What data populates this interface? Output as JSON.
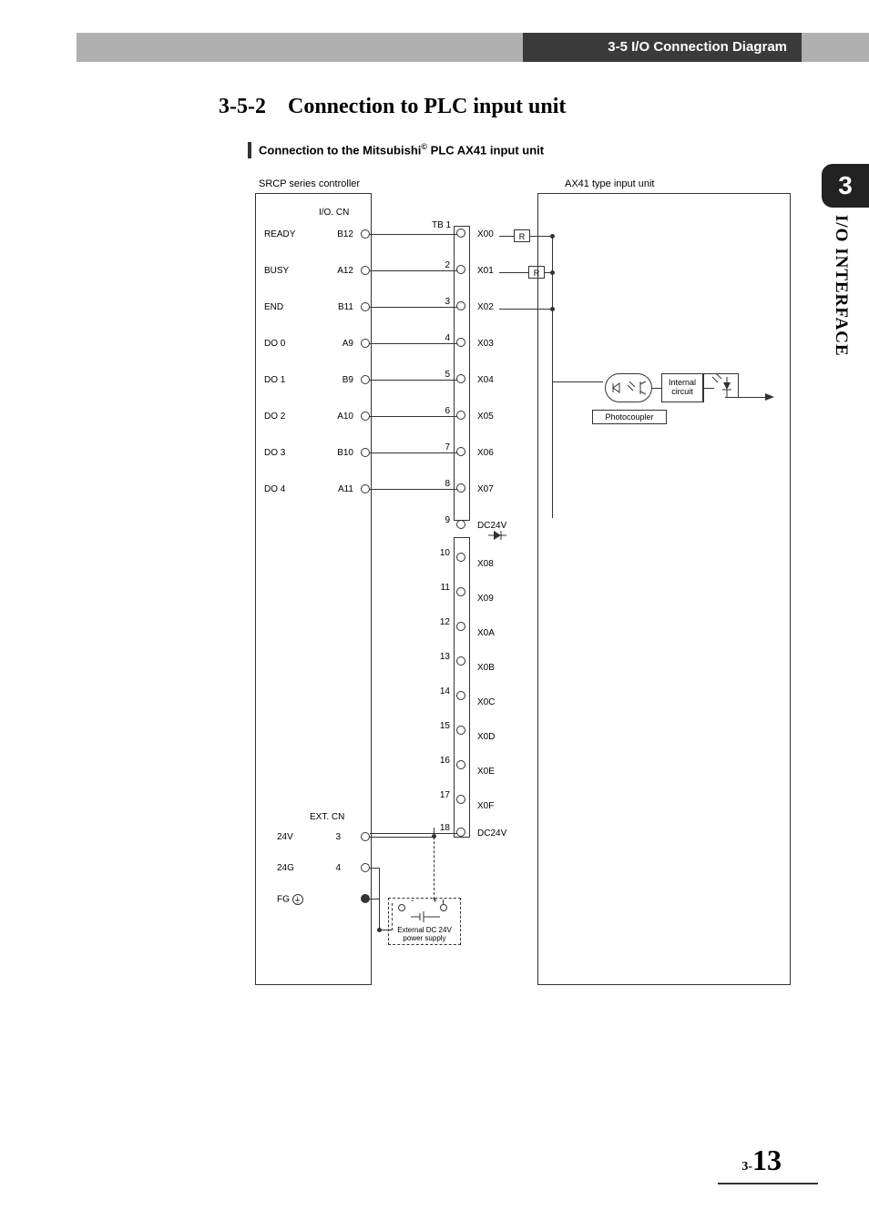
{
  "header": "3-5 I/O Connection Diagram",
  "section_number": "3-5-2",
  "section_title": "Connection to PLC input unit",
  "caption_prefix": "Connection to the Mitsubishi",
  "caption_sup": "©",
  "caption_suffix": " PLC AX41 input unit",
  "side_tab_number": "3",
  "side_tab_text": "I/O INTERFACE",
  "diagram": {
    "left_box_label": "SRCP series controller",
    "right_box_label": "AX41 type input unit",
    "io_cn": "I/O. CN",
    "tb1": "TB 1",
    "ext_cn": "EXT. CN",
    "rows_top": [
      {
        "sig": "READY",
        "pin": "B12",
        "term": "1",
        "x": "X00",
        "r": true
      },
      {
        "sig": "BUSY",
        "pin": "A12",
        "term": "2",
        "x": "X01",
        "r": true
      },
      {
        "sig": "END",
        "pin": "B11",
        "term": "3",
        "x": "X02"
      },
      {
        "sig": "DO 0",
        "pin": "A9",
        "term": "4",
        "x": "X03"
      },
      {
        "sig": "DO 1",
        "pin": "B9",
        "term": "5",
        "x": "X04"
      },
      {
        "sig": "DO 2",
        "pin": "A10",
        "term": "6",
        "x": "X05"
      },
      {
        "sig": "DO 3",
        "pin": "B10",
        "term": "7",
        "x": "X06"
      },
      {
        "sig": "DO 4",
        "pin": "A11",
        "term": "8",
        "x": "X07"
      }
    ],
    "row_dc_top": {
      "term": "9",
      "x": "DC24V"
    },
    "rows_mid": [
      {
        "term": "10",
        "x": "X08"
      },
      {
        "term": "11",
        "x": "X09"
      },
      {
        "term": "12",
        "x": "X0A"
      },
      {
        "term": "13",
        "x": "X0B"
      },
      {
        "term": "14",
        "x": "X0C"
      },
      {
        "term": "15",
        "x": "X0D"
      },
      {
        "term": "16",
        "x": "X0E"
      },
      {
        "term": "17",
        "x": "X0F"
      }
    ],
    "row_dc_bot": {
      "term": "18",
      "x": "DC24V"
    },
    "rows_bot": [
      {
        "sig": "24V",
        "pin": "3"
      },
      {
        "sig": "24G",
        "pin": "4"
      },
      {
        "sig": "FG",
        "pin": ""
      }
    ],
    "internal_circuit": "Internal circuit",
    "photocoupler": "Photocoupler",
    "power_supply_label": "External DC 24V power supply",
    "ps_minus": "-",
    "ps_plus": "+"
  },
  "page_prefix": "3-",
  "page_number": "13"
}
